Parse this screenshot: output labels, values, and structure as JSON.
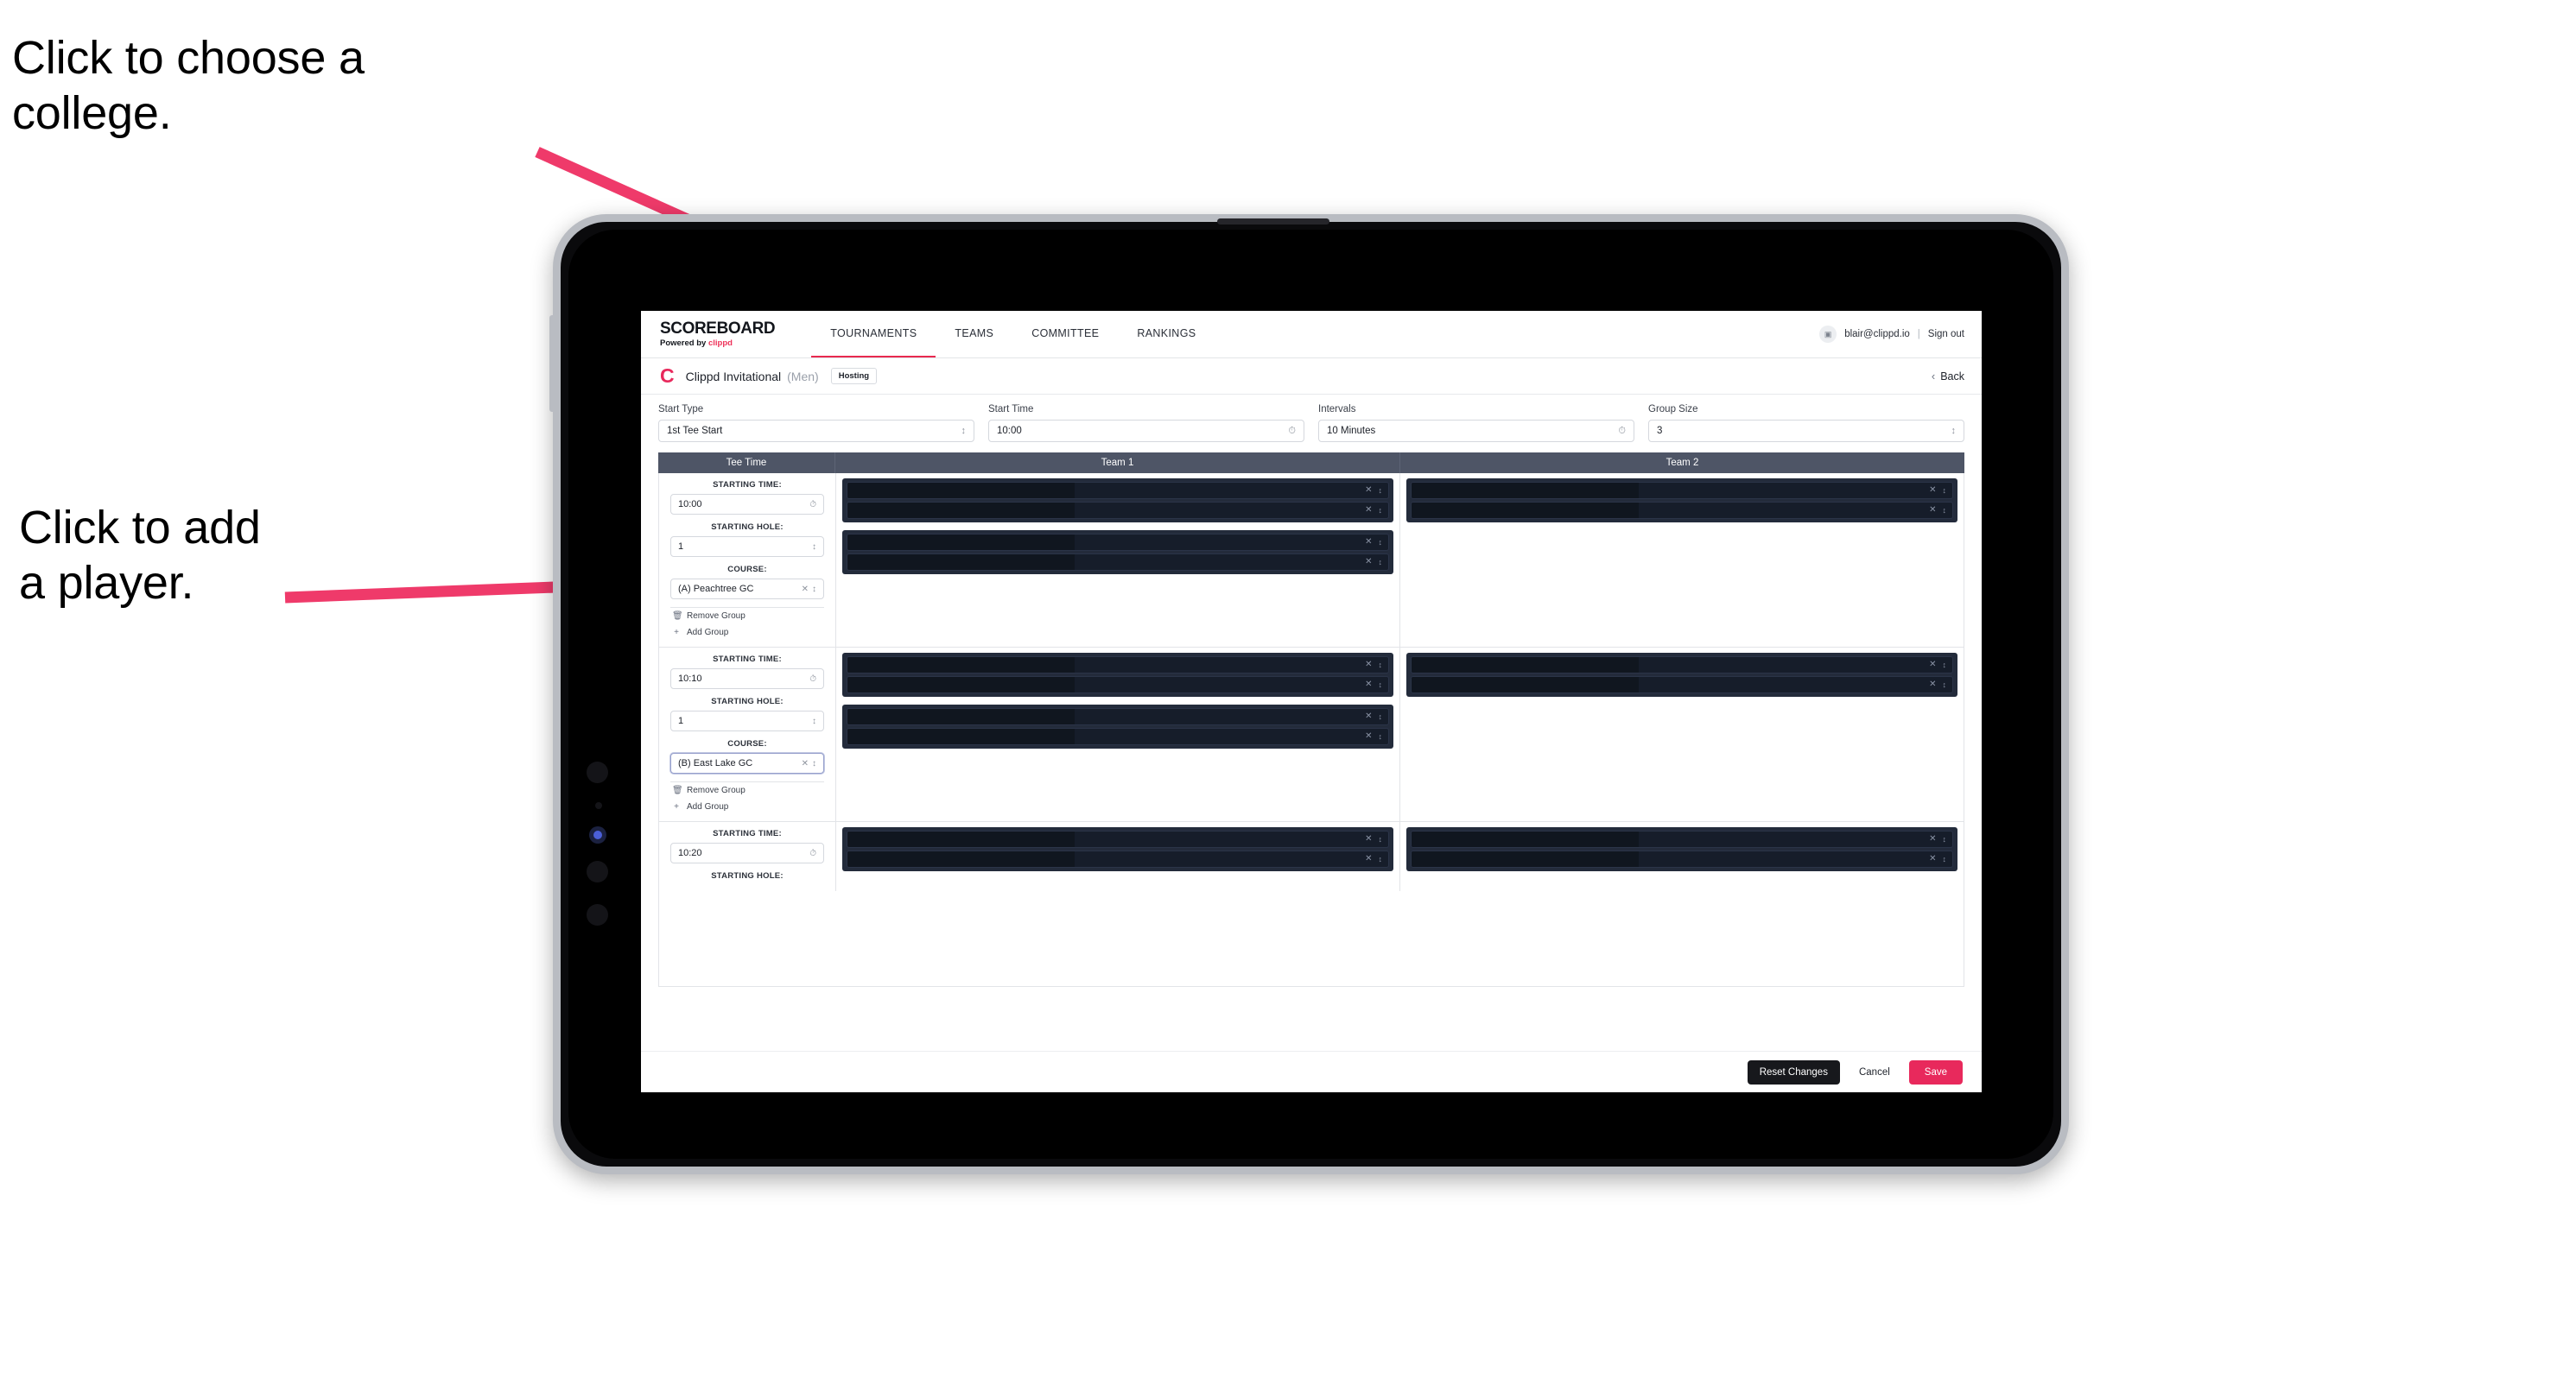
{
  "annotations": {
    "college": "Click to choose a\ncollege.",
    "player": "Click to add\na player."
  },
  "colors": {
    "accent_pink": "#e8295c",
    "annotation_arrow": "#ef3a6a",
    "table_header": "#4e5566",
    "card_outer": "#232b3b",
    "card_row": "#161d2a",
    "reset_button": "#17181c"
  },
  "topnav": {
    "brand_title": "SCOREBOARD",
    "brand_sub_prefix": "Powered by ",
    "brand_sub_accent": "clippd",
    "tabs": [
      {
        "label": "TOURNAMENTS",
        "active": true
      },
      {
        "label": "TEAMS",
        "active": false
      },
      {
        "label": "COMMITTEE",
        "active": false
      },
      {
        "label": "RANKINGS",
        "active": false
      }
    ],
    "avatar_icon": "user-avatar-icon",
    "user_email": "blair@clippd.io",
    "separator": "|",
    "sign_out": "Sign out"
  },
  "tournament_bar": {
    "logo_letter": "C",
    "name": "Clippd Invitational",
    "gender": "(Men)",
    "badge": "Hosting",
    "back_label": "Back",
    "back_chevron": "chevron-left-icon"
  },
  "controls": [
    {
      "label": "Start Type",
      "value": "1st Tee Start",
      "icon": "stepper-icon",
      "glyph": "⌃⌄"
    },
    {
      "label": "Start Time",
      "value": "10:00",
      "icon": "clock-icon",
      "glyph": "◴"
    },
    {
      "label": "Intervals",
      "value": "10 Minutes",
      "icon": "clock-icon",
      "glyph": "◴"
    },
    {
      "label": "Group Size",
      "value": "3",
      "icon": "stepper-icon",
      "glyph": "⌃⌄"
    }
  ],
  "table": {
    "headers": [
      "Tee Time",
      "Team 1",
      "Team 2"
    ],
    "field_labels": {
      "starting_time": "STARTING TIME:",
      "starting_hole": "STARTING HOLE:",
      "course": "COURSE:"
    },
    "group_actions": {
      "remove": "Remove Group",
      "remove_icon": "trash-icon",
      "remove_glyph": "Ὕ1",
      "add": "Add Group",
      "add_icon": "plus-icon",
      "add_glyph": "+"
    },
    "rows": [
      {
        "starting_time": "10:00",
        "starting_hole": "1",
        "course": "(A) Peachtree GC",
        "course_focused": false,
        "team1_cards": [
          2,
          2
        ],
        "team2_cards": [
          2
        ]
      },
      {
        "starting_time": "10:10",
        "starting_hole": "1",
        "course": "(B) East Lake GC",
        "course_focused": true,
        "team1_cards": [
          2,
          2
        ],
        "team2_cards": [
          2
        ]
      },
      {
        "starting_time": "10:20",
        "starting_hole": "",
        "course": "",
        "course_focused": false,
        "team1_cards": [
          2
        ],
        "team2_cards": [
          2
        ]
      }
    ],
    "row_icons": {
      "clear": "close-x-icon",
      "clear_glyph": "✕",
      "stepper": "stepper-icon",
      "stepper_glyph": "⌃⌄"
    }
  },
  "footer": {
    "reset": "Reset Changes",
    "cancel": "Cancel",
    "save": "Save"
  }
}
